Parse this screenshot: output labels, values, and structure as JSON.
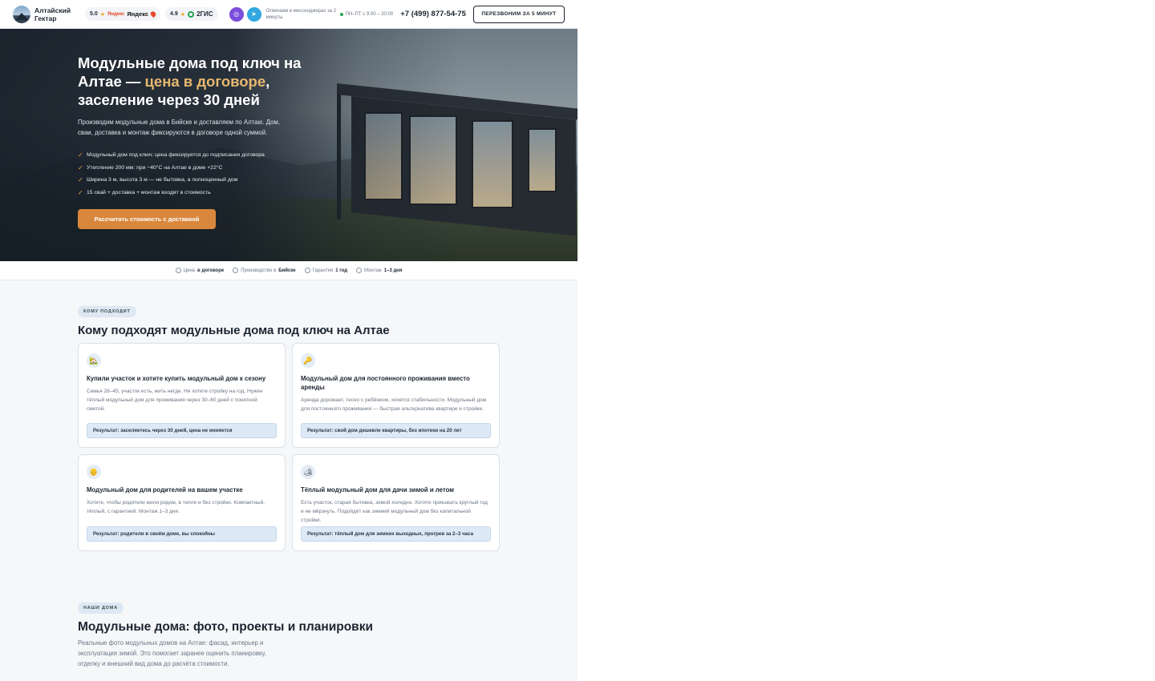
{
  "header": {
    "logo_text": "Алтайский Гектар",
    "ratings": [
      {
        "score": "5.0",
        "brand_small": "Яндекс",
        "brand": "Яндекс"
      },
      {
        "score": "4.9",
        "brand": "2ГИС"
      }
    ],
    "messenger_note": "Отвечаем в мессенджерах за 2 минуты",
    "hours": "ПН–ПТ с 9:00 – 20:00",
    "phone": "+7 (499) 877-54-75",
    "callback_label": "ПЕРЕЗВОНИМ ЗА 5 МИНУТ",
    "icons": {
      "max": "max-messenger-icon",
      "telegram": "telegram-icon"
    }
  },
  "hero": {
    "title_part1": "Модульные дома под ключ на Алтае — ",
    "title_accent": "цена в договоре",
    "title_part2": ", заселение через 30 дней",
    "subtitle": "Производим модульные дома в Бийске и доставляем по Алтаю. Дом, сваи, доставка и монтаж фиксируются в договоре одной суммой.",
    "bullets": [
      "Модульный дом под ключ: цена фиксируется до подписания договора",
      "Утепление 200 мм: при −40°C на Алтае в доме +22°C",
      "Ширина 3 м, высота 3 м — не бытовка, а полноценный дом",
      "15 свай + доставка + монтаж входят в стоимость"
    ],
    "cta_label": "Рассчитать стоимость с доставкой",
    "accent_color": "#e7b86e",
    "cta_color": "#d9873d"
  },
  "trust": [
    {
      "label": "Цена ",
      "value": "в договоре",
      "icon": "shield-icon"
    },
    {
      "label": "Производство в ",
      "value": "Бийске",
      "icon": "location-pin-icon"
    },
    {
      "label": "Гарантия ",
      "value": "1 год",
      "icon": "clock-icon"
    },
    {
      "label": "Монтаж ",
      "value": "1–3 дня",
      "icon": "tools-icon"
    }
  ],
  "section_fit": {
    "chip": "КОМУ ПОДХОДИТ",
    "title": "Кому подходят модульные дома под ключ на Алтае",
    "cards": [
      {
        "icon": "🏡",
        "title": "Купили участок и хотите купить модульный дом к сезону",
        "text": "Семья 28–45, участок есть, жить негде. Не хотите стройку на год. Нужен тёплый модульный дом для проживания через 30–60 дней с понятной сметой.",
        "result": "Результат: заселяетесь через 30 дней, цена не меняется"
      },
      {
        "icon": "🔑",
        "title": "Модульный дом для постоянного проживания вместо аренды",
        "text": "Аренда дорожает, тесно с ребёнком, хочется стабильности. Модульный дом для постоянного проживания — быстрая альтернатива квартире и стройке.",
        "result": "Результат: свой дом дешевле квартиры, без ипотеки на 20 лет"
      },
      {
        "icon": "👴",
        "title": "Модульный дом для родителей на вашем участке",
        "text": "Хотите, чтобы родители жили рядом, в тепле и без стройки. Компактный, тёплый, с гарантией. Монтаж 1–3 дня.",
        "result": "Результат: родители в своём доме, вы спокойны"
      },
      {
        "icon": "🏕",
        "title": "Тёплый модульный дом для дачи зимой и летом",
        "text": "Есть участок, старая бытовка, зимой холодно. Хотите приезжать круглый год и не мёрзнуть. Подойдёт как зимний модульный дом без капитальной стройки.",
        "result": "Результат: тёплый дом для зимних выходных, прогрев за 2–3 часа"
      }
    ]
  },
  "section_homes": {
    "chip": "НАШИ ДОМА",
    "title": "Модульные дома: фото, проекты и планировки",
    "subtitle": "Реальные фото модульных домов на Алтае: фасад, интерьер и эксплуатация зимой. Это помогает заранее оценить планировку, отделку и внешний вид дома до расчёта стоимости."
  }
}
